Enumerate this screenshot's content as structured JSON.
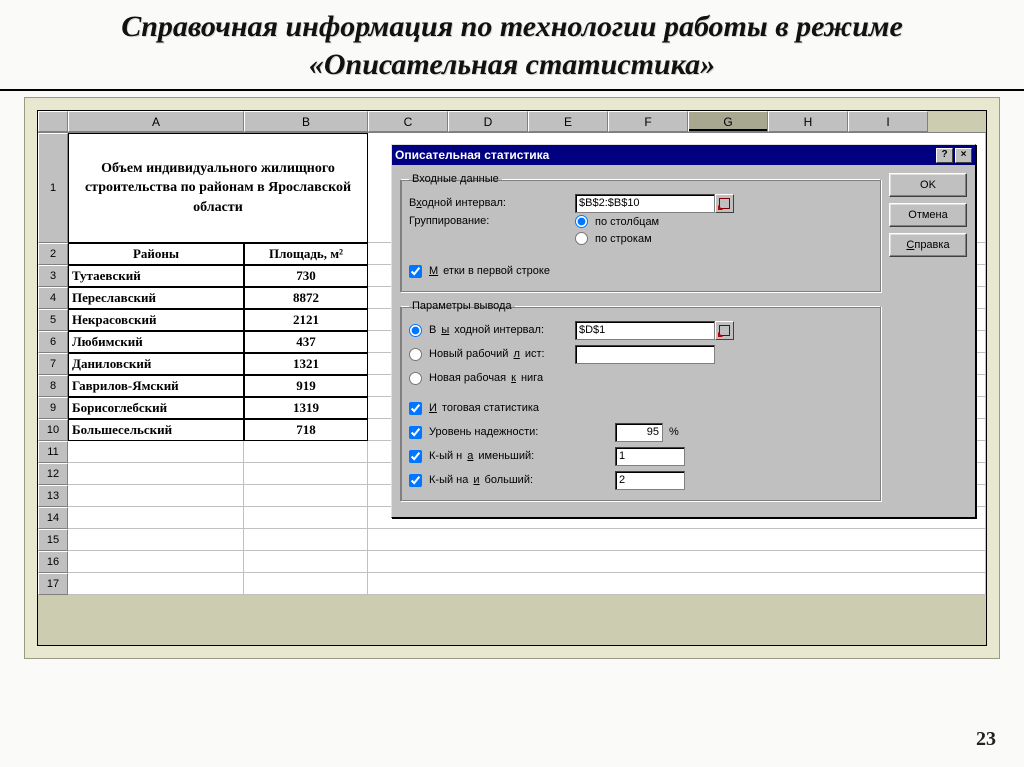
{
  "page": {
    "title": "Справочная информация по технологии работы в режиме «Описательная статистика»",
    "number": "23"
  },
  "columns": [
    "A",
    "B",
    "C",
    "D",
    "E",
    "F",
    "G",
    "H",
    "I"
  ],
  "active_col": "G",
  "sheet_title": "Объем индивидуального жилищного строительства по районам в Ярославской области",
  "headers": {
    "colA": "Районы",
    "colB": "Площадь, м²"
  },
  "rows": [
    {
      "n": "3",
      "a": "Тутаевский",
      "b": "730"
    },
    {
      "n": "4",
      "a": "Переславский",
      "b": "8872"
    },
    {
      "n": "5",
      "a": "Некрасовский",
      "b": "2121"
    },
    {
      "n": "6",
      "a": "Любимский",
      "b": "437"
    },
    {
      "n": "7",
      "a": "Даниловский",
      "b": "1321"
    },
    {
      "n": "8",
      "a": "Гаврилов-Ямский",
      "b": "919"
    },
    {
      "n": "9",
      "a": "Борисоглебский",
      "b": "1319"
    },
    {
      "n": "10",
      "a": "Большесельский",
      "b": "718"
    }
  ],
  "empty_rows": [
    "11",
    "12",
    "13",
    "14",
    "15",
    "16",
    "17"
  ],
  "dialog": {
    "title": "Описательная статистика",
    "buttons": {
      "ok": "OK",
      "cancel": "Отмена",
      "help": "Справка"
    },
    "input_group": "Входные данные",
    "output_group": "Параметры вывода",
    "labels": {
      "input_range": "Входной интервал:",
      "grouping": "Группирование:",
      "by_columns": "по столбцам",
      "by_rows": "по строкам",
      "labels_first_row": "Метки в первой строке",
      "output_range": "Выходной интервал:",
      "new_sheet": "Новый рабочий лист:",
      "new_book": "Новая рабочая книга",
      "summary": "Итоговая статистика",
      "confidence": "Уровень надежности:",
      "kth_min": "К-ый наименьший:",
      "kth_max": "К-ый наибольший:",
      "percent": "%"
    },
    "values": {
      "input_range": "$B$2:$B$10",
      "output_range": "$D$1",
      "confidence": "95",
      "kth_min": "1",
      "kth_max": "2",
      "new_sheet": ""
    }
  }
}
